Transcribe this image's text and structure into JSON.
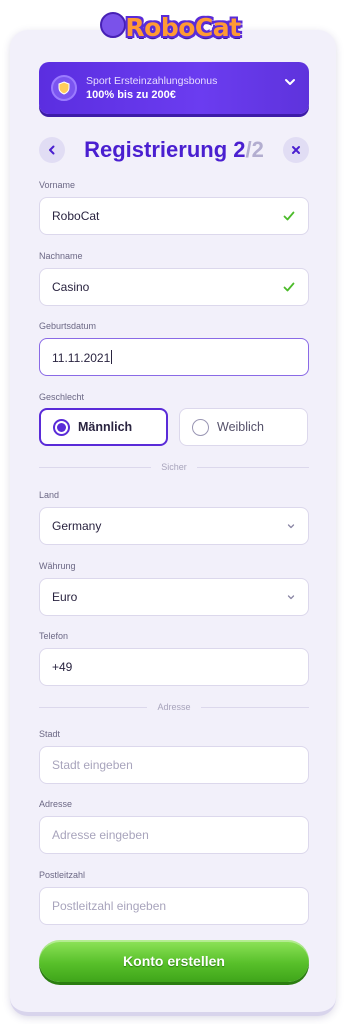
{
  "logo": {
    "text": "RoboCat"
  },
  "bonus": {
    "title": "Sport Ersteinzahlungsbonus",
    "amount": "100% bis zu 200€",
    "icon": "shield-icon"
  },
  "header": {
    "title_main": "Registrierung 2",
    "title_total": "/2",
    "back_icon": "chevron-left-icon",
    "close_icon": "close-icon"
  },
  "form": {
    "first_name": {
      "label": "Vorname",
      "value": "RoboCat"
    },
    "last_name": {
      "label": "Nachname",
      "value": "Casino"
    },
    "birthdate": {
      "label": "Geburtsdatum",
      "value": "11.11.2021"
    },
    "gender": {
      "label": "Geschlecht",
      "male": "Männlich",
      "female": "Weiblich",
      "selected": "male"
    },
    "divider_secure": "Sicher",
    "country": {
      "label": "Land",
      "value": "Germany"
    },
    "currency": {
      "label": "Währung",
      "value": "Euro"
    },
    "phone": {
      "label": "Telefon",
      "value": "+49"
    },
    "divider_address": "Adresse",
    "city": {
      "label": "Stadt",
      "placeholder": "Stadt eingeben"
    },
    "address": {
      "label": "Adresse",
      "placeholder": "Adresse eingeben"
    },
    "zip": {
      "label": "Postleitzahl",
      "placeholder": "Postleitzahl eingeben"
    },
    "submit_label": "Konto erstellen"
  },
  "colors": {
    "accent": "#5a2bd8",
    "success": "#4cbb2a",
    "button_green": "#58c02a"
  }
}
